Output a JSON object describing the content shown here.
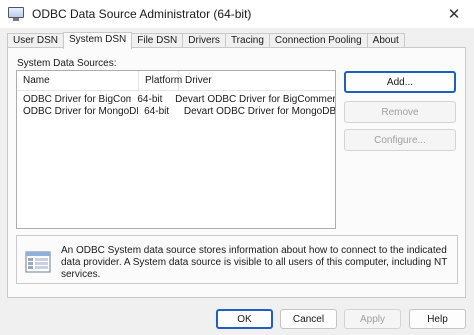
{
  "window": {
    "title": "ODBC Data Source Administrator (64-bit)",
    "close_glyph": "✕"
  },
  "tabs": [
    {
      "label": "User DSN",
      "active": false
    },
    {
      "label": "System DSN",
      "active": true
    },
    {
      "label": "File DSN",
      "active": false
    },
    {
      "label": "Drivers",
      "active": false
    },
    {
      "label": "Tracing",
      "active": false
    },
    {
      "label": "Connection Pooling",
      "active": false
    },
    {
      "label": "About",
      "active": false
    }
  ],
  "system_dsn": {
    "list_label": "System Data Sources:",
    "columns": [
      "Name",
      "Platform",
      "Driver"
    ],
    "rows": [
      {
        "name": "ODBC Driver for BigCommerce",
        "platform": "64-bit",
        "driver": "Devart ODBC Driver for BigCommerce"
      },
      {
        "name": "ODBC Driver for MongoDB",
        "platform": "64-bit",
        "driver": "Devart ODBC Driver for MongoDB"
      }
    ],
    "buttons": {
      "add": "Add...",
      "remove": "Remove",
      "configure": "Configure..."
    },
    "info_text": "An ODBC System data source stores information about how to connect to the indicated data provider. A System data source is visible to all users of this computer, including NT services."
  },
  "footer": {
    "ok": "OK",
    "cancel": "Cancel",
    "apply": "Apply",
    "help": "Help"
  },
  "icons": {
    "app": "odbc-monitor-icon",
    "info": "datasource-document-icon"
  },
  "colors": {
    "accent": "#1f5fc2"
  }
}
